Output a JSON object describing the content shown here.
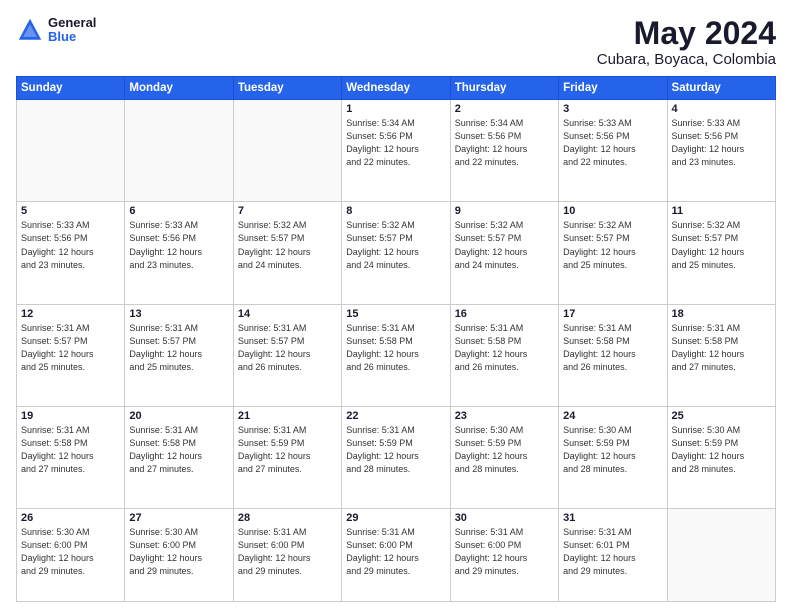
{
  "header": {
    "logo_line1": "General",
    "logo_line2": "Blue",
    "title": "May 2024",
    "subtitle": "Cubara, Boyaca, Colombia"
  },
  "weekdays": [
    "Sunday",
    "Monday",
    "Tuesday",
    "Wednesday",
    "Thursday",
    "Friday",
    "Saturday"
  ],
  "weeks": [
    [
      {
        "day": "",
        "info": ""
      },
      {
        "day": "",
        "info": ""
      },
      {
        "day": "",
        "info": ""
      },
      {
        "day": "1",
        "info": "Sunrise: 5:34 AM\nSunset: 5:56 PM\nDaylight: 12 hours\nand 22 minutes."
      },
      {
        "day": "2",
        "info": "Sunrise: 5:34 AM\nSunset: 5:56 PM\nDaylight: 12 hours\nand 22 minutes."
      },
      {
        "day": "3",
        "info": "Sunrise: 5:33 AM\nSunset: 5:56 PM\nDaylight: 12 hours\nand 22 minutes."
      },
      {
        "day": "4",
        "info": "Sunrise: 5:33 AM\nSunset: 5:56 PM\nDaylight: 12 hours\nand 23 minutes."
      }
    ],
    [
      {
        "day": "5",
        "info": "Sunrise: 5:33 AM\nSunset: 5:56 PM\nDaylight: 12 hours\nand 23 minutes."
      },
      {
        "day": "6",
        "info": "Sunrise: 5:33 AM\nSunset: 5:56 PM\nDaylight: 12 hours\nand 23 minutes."
      },
      {
        "day": "7",
        "info": "Sunrise: 5:32 AM\nSunset: 5:57 PM\nDaylight: 12 hours\nand 24 minutes."
      },
      {
        "day": "8",
        "info": "Sunrise: 5:32 AM\nSunset: 5:57 PM\nDaylight: 12 hours\nand 24 minutes."
      },
      {
        "day": "9",
        "info": "Sunrise: 5:32 AM\nSunset: 5:57 PM\nDaylight: 12 hours\nand 24 minutes."
      },
      {
        "day": "10",
        "info": "Sunrise: 5:32 AM\nSunset: 5:57 PM\nDaylight: 12 hours\nand 25 minutes."
      },
      {
        "day": "11",
        "info": "Sunrise: 5:32 AM\nSunset: 5:57 PM\nDaylight: 12 hours\nand 25 minutes."
      }
    ],
    [
      {
        "day": "12",
        "info": "Sunrise: 5:31 AM\nSunset: 5:57 PM\nDaylight: 12 hours\nand 25 minutes."
      },
      {
        "day": "13",
        "info": "Sunrise: 5:31 AM\nSunset: 5:57 PM\nDaylight: 12 hours\nand 25 minutes."
      },
      {
        "day": "14",
        "info": "Sunrise: 5:31 AM\nSunset: 5:57 PM\nDaylight: 12 hours\nand 26 minutes."
      },
      {
        "day": "15",
        "info": "Sunrise: 5:31 AM\nSunset: 5:58 PM\nDaylight: 12 hours\nand 26 minutes."
      },
      {
        "day": "16",
        "info": "Sunrise: 5:31 AM\nSunset: 5:58 PM\nDaylight: 12 hours\nand 26 minutes."
      },
      {
        "day": "17",
        "info": "Sunrise: 5:31 AM\nSunset: 5:58 PM\nDaylight: 12 hours\nand 26 minutes."
      },
      {
        "day": "18",
        "info": "Sunrise: 5:31 AM\nSunset: 5:58 PM\nDaylight: 12 hours\nand 27 minutes."
      }
    ],
    [
      {
        "day": "19",
        "info": "Sunrise: 5:31 AM\nSunset: 5:58 PM\nDaylight: 12 hours\nand 27 minutes."
      },
      {
        "day": "20",
        "info": "Sunrise: 5:31 AM\nSunset: 5:58 PM\nDaylight: 12 hours\nand 27 minutes."
      },
      {
        "day": "21",
        "info": "Sunrise: 5:31 AM\nSunset: 5:59 PM\nDaylight: 12 hours\nand 27 minutes."
      },
      {
        "day": "22",
        "info": "Sunrise: 5:31 AM\nSunset: 5:59 PM\nDaylight: 12 hours\nand 28 minutes."
      },
      {
        "day": "23",
        "info": "Sunrise: 5:30 AM\nSunset: 5:59 PM\nDaylight: 12 hours\nand 28 minutes."
      },
      {
        "day": "24",
        "info": "Sunrise: 5:30 AM\nSunset: 5:59 PM\nDaylight: 12 hours\nand 28 minutes."
      },
      {
        "day": "25",
        "info": "Sunrise: 5:30 AM\nSunset: 5:59 PM\nDaylight: 12 hours\nand 28 minutes."
      }
    ],
    [
      {
        "day": "26",
        "info": "Sunrise: 5:30 AM\nSunset: 6:00 PM\nDaylight: 12 hours\nand 29 minutes."
      },
      {
        "day": "27",
        "info": "Sunrise: 5:30 AM\nSunset: 6:00 PM\nDaylight: 12 hours\nand 29 minutes."
      },
      {
        "day": "28",
        "info": "Sunrise: 5:31 AM\nSunset: 6:00 PM\nDaylight: 12 hours\nand 29 minutes."
      },
      {
        "day": "29",
        "info": "Sunrise: 5:31 AM\nSunset: 6:00 PM\nDaylight: 12 hours\nand 29 minutes."
      },
      {
        "day": "30",
        "info": "Sunrise: 5:31 AM\nSunset: 6:00 PM\nDaylight: 12 hours\nand 29 minutes."
      },
      {
        "day": "31",
        "info": "Sunrise: 5:31 AM\nSunset: 6:01 PM\nDaylight: 12 hours\nand 29 minutes."
      },
      {
        "day": "",
        "info": ""
      }
    ]
  ]
}
